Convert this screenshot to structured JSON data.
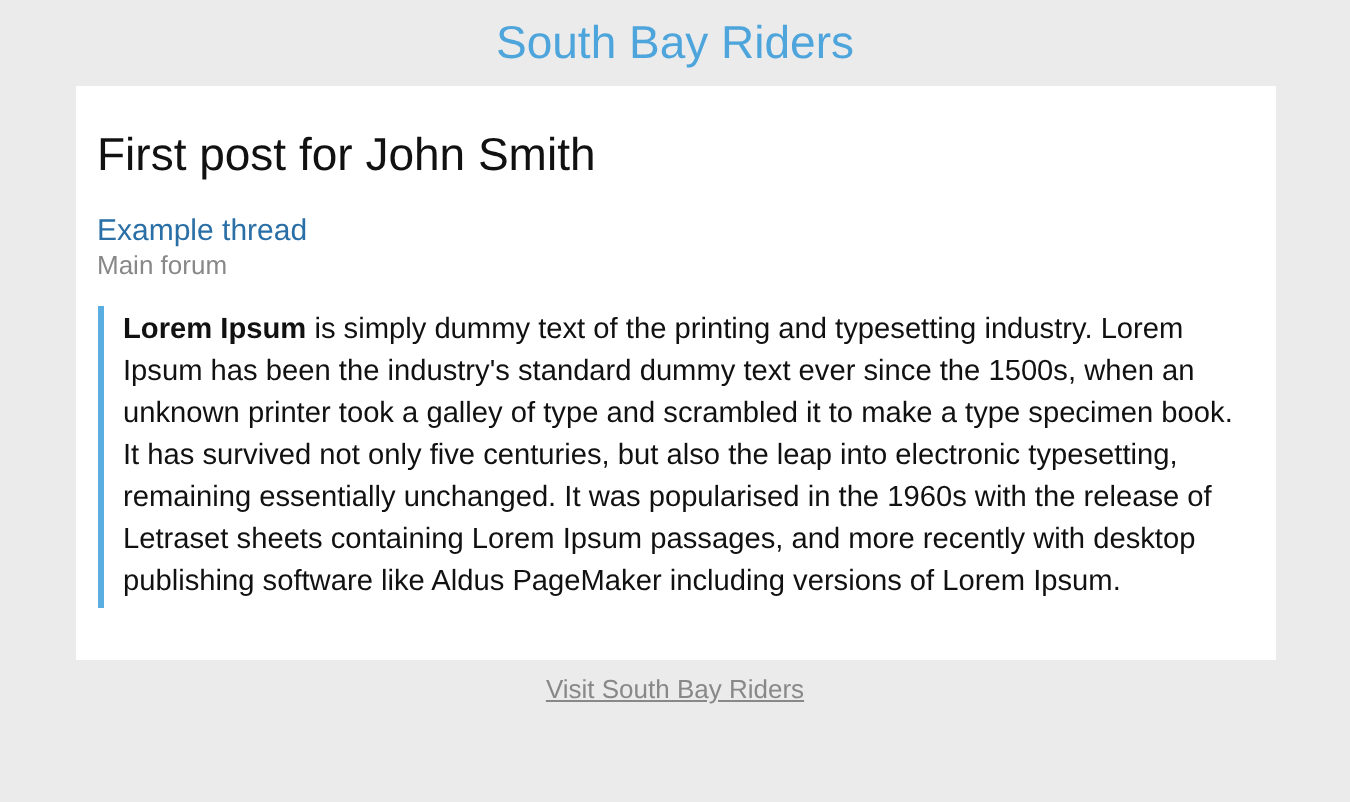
{
  "site_title": "South Bay Riders",
  "post": {
    "heading": "First post for John Smith",
    "thread_link": "Example thread",
    "forum": "Main forum",
    "body": "**Lorem Ipsum** is simply dummy text of the printing and typesetting industry. Lorem Ipsum has been the industry's standard dummy text ever since the 1500s, when an unknown printer took a galley of type and scrambled it to make a type specimen book. It has survived not only five centuries, but also the leap into electronic typesetting, remaining essentially unchanged. It was popularised in the 1960s with the release of Letraset sheets containing Lorem Ipsum passages, and more recently with desktop publishing software like Aldus PageMaker including versions of Lorem Ipsum."
  },
  "footer_link": "Visit South Bay Riders"
}
